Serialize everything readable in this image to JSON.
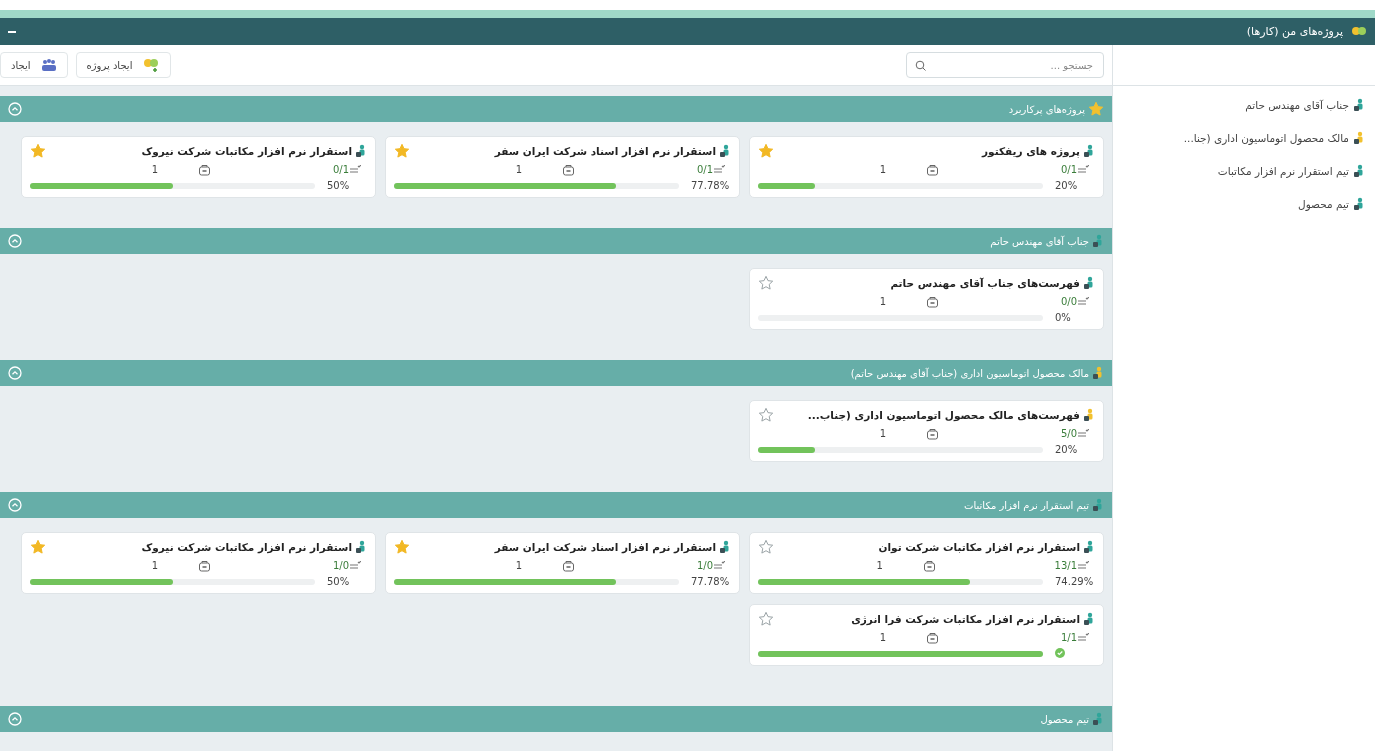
{
  "header": {
    "title": "پروژه‌های من (کارها)"
  },
  "toolbar": {
    "search": {
      "placeholder": "جستجو ..."
    },
    "buttons": [
      {
        "label": "ایجاد پروژه",
        "kind": "project"
      },
      {
        "label": "ایجاد",
        "kind": "team"
      }
    ]
  },
  "sections": [
    {
      "title": "پروژه‌های پرکاربرد",
      "kind": "star",
      "color": "#f2c12e",
      "expanded": true,
      "cards": [
        {
          "title": "پروژه های ریفکتور",
          "color": "#2fa59a",
          "starred": true,
          "tasks": "0/1",
          "members": "1",
          "percent": "20%",
          "level": 0.2,
          "done": false
        },
        {
          "title": "استقرار نرم افزار اسناد شرکت ایران سفر",
          "color": "#2fa59a",
          "starred": true,
          "tasks": "0/1",
          "members": "1",
          "percent": "77.78%",
          "level": 0.7778,
          "done": false
        },
        {
          "title": "استقرار نرم افزار مکاتبات شرکت نیروک",
          "color": "#2fa59a",
          "starred": true,
          "tasks": "0/1",
          "members": "1",
          "percent": "50%",
          "level": 0.5,
          "done": false
        }
      ]
    },
    {
      "title": "جناب آقای مهندس حاتم",
      "kind": "person",
      "color": "#2fa59a",
      "expanded": true,
      "cards": [
        {
          "title": "فهرست‌های جناب آقای مهندس حاتم",
          "color": "#2fa59a",
          "starred": false,
          "tasks": "0/0",
          "members": "1",
          "percent": "0%",
          "level": 0,
          "done": false
        }
      ]
    },
    {
      "title": "مالک محصول اتوماسیون اداری (جناب آقای مهندس حاتم)",
      "kind": "person",
      "color": "#f2c12e",
      "expanded": true,
      "cards": [
        {
          "title": "فهرست‌های مالک محصول اتوماسیون اداری (جناب...",
          "color": "#f2c12e",
          "starred": false,
          "tasks": "5/0",
          "members": "1",
          "percent": "20%",
          "level": 0.2,
          "done": false
        }
      ]
    },
    {
      "title": "تیم استقرار نرم افزار مکاتبات",
      "kind": "person",
      "color": "#2fa59a",
      "expanded": true,
      "cards": [
        {
          "title": "استقرار نرم افزار مکاتبات شرکت توان",
          "color": "#2fa59a",
          "starred": false,
          "tasks": "13/1",
          "members": "1",
          "percent": "74.29%",
          "level": 0.7429,
          "done": false
        },
        {
          "title": "استقرار نرم افزار اسناد شرکت ایران سفر",
          "color": "#2fa59a",
          "starred": true,
          "tasks": "1/0",
          "members": "1",
          "percent": "77.78%",
          "level": 0.7778,
          "done": false
        },
        {
          "title": "استقرار نرم افزار مکاتبات شرکت نیروک",
          "color": "#2fa59a",
          "starred": true,
          "tasks": "1/0",
          "members": "1",
          "percent": "50%",
          "level": 0.5,
          "done": false
        },
        {
          "title": "استقرار نرم افزار مکاتبات شرکت فرا انرژی",
          "color": "#2fa59a",
          "starred": false,
          "tasks": "1/1",
          "members": "1",
          "level": 1,
          "done": true
        }
      ]
    },
    {
      "title": "تیم محصول",
      "kind": "person",
      "color": "#2fa59a",
      "expanded": true
    }
  ],
  "sidebar": {
    "items": [
      {
        "label": "جناب آقای مهندس حاتم",
        "color": "#2fa59a"
      },
      {
        "label": "مالک محصول اتوماسیون اداری (جنا...",
        "color": "#f2c12e"
      },
      {
        "label": "تیم استقرار نرم افزار مکاتبات",
        "color": "#2fa59a"
      },
      {
        "label": "تیم محصول",
        "color": "#2fa59a"
      }
    ]
  }
}
